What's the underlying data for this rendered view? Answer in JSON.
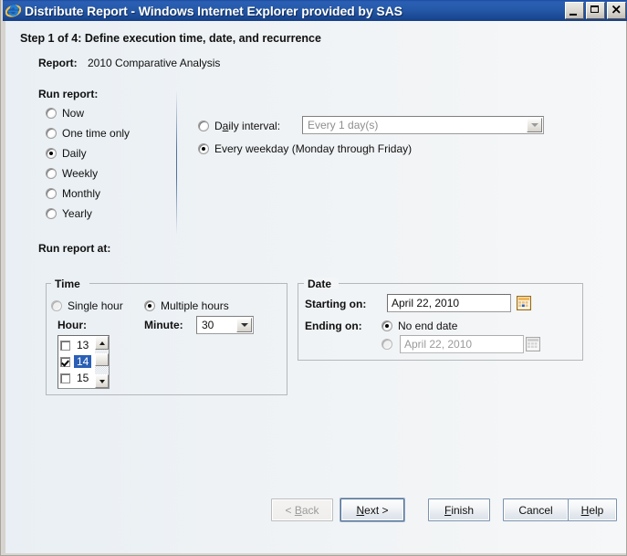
{
  "window": {
    "title": "Distribute Report - Windows Internet Explorer provided by SAS",
    "app_icon": "internet-explorer-icon",
    "controls": {
      "minimize": "_",
      "maximize": "□",
      "close": "✕"
    },
    "titlebar_color": "#1c4b9c"
  },
  "header": {
    "step_title": "Step 1 of 4: Define execution time, date, and recurrence",
    "report_label": "Report:",
    "report_value": "2010 Comparative Analysis"
  },
  "run_report": {
    "label": "Run report:",
    "options": [
      {
        "label": "Now",
        "checked": false
      },
      {
        "label": "One time only",
        "checked": false
      },
      {
        "label": "Daily",
        "checked": true
      },
      {
        "label": "Weekly",
        "checked": false
      },
      {
        "label": "Monthly",
        "checked": false
      },
      {
        "label": "Yearly",
        "checked": false
      }
    ]
  },
  "recurrence": {
    "daily_interval": {
      "label_before": "D",
      "label_acc": "a",
      "label_after": "ily interval:",
      "checked": false,
      "combo_value": "Every 1 day(s)",
      "disabled": true
    },
    "every_weekday": {
      "label_before": "Every weekday (Monday throu",
      "label_acc": "g",
      "label_after": "h Friday)",
      "checked": true
    }
  },
  "run_report_at": {
    "label": "Run report at:",
    "time_group": {
      "title": "Time",
      "single_hour": {
        "label": "Single hour",
        "checked": false,
        "disabled": true
      },
      "multiple_hours": {
        "label": "Multiple hours",
        "checked": true
      },
      "hour_label": "Hour:",
      "hours": [
        {
          "value": "13",
          "checked": false,
          "selected": false
        },
        {
          "value": "14",
          "checked": true,
          "selected": true
        },
        {
          "value": "15",
          "checked": false,
          "selected": false
        }
      ],
      "minute_label": "Minute:",
      "minute_value": "30"
    },
    "date_group": {
      "title": "Date",
      "starting_label": "Starting on:",
      "starting_value": "April 22, 2010",
      "starting_calendar_icon": "calendar-icon",
      "ending_label": "Ending on:",
      "no_end_date": {
        "label": "No end date",
        "checked": true
      },
      "end_date": {
        "checked": false,
        "value": "April 22, 2010",
        "disabled": true
      },
      "ending_calendar_icon": "calendar-icon-disabled"
    }
  },
  "buttons": {
    "back": {
      "before": "< ",
      "acc": "B",
      "after": "ack",
      "disabled": true,
      "default": false
    },
    "next": {
      "before": "",
      "acc": "N",
      "after": "ext >",
      "disabled": false,
      "default": true
    },
    "finish": {
      "before": "",
      "acc": "F",
      "after": "inish",
      "disabled": false,
      "default": false
    },
    "cancel": {
      "before": "Cancel",
      "acc": "",
      "after": "",
      "disabled": false,
      "default": false
    },
    "help": {
      "before": "",
      "acc": "H",
      "after": "elp",
      "disabled": false,
      "default": false
    }
  }
}
